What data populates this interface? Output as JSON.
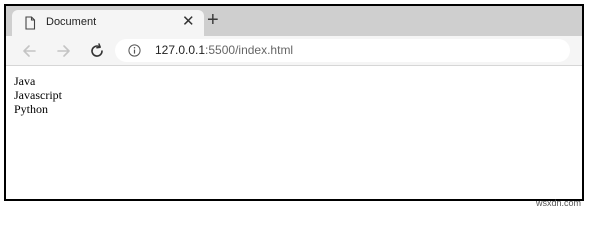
{
  "tab": {
    "title": "Document",
    "close_icon": "close-icon",
    "new_tab_icon": "plus-icon"
  },
  "toolbar": {
    "back_icon": "arrow-left-icon",
    "forward_icon": "arrow-right-icon",
    "reload_icon": "reload-icon",
    "info_icon": "info-icon"
  },
  "address": {
    "host": "127.0.0.1",
    "rest": ":5500/index.html"
  },
  "content": {
    "lines": [
      "Java",
      "Javascript",
      "Python"
    ]
  },
  "watermark": "wsxdn.com",
  "colors": {
    "tabstrip": "#cfcfcf",
    "toolbar": "#f5f5f5",
    "frame_border": "#000000"
  }
}
